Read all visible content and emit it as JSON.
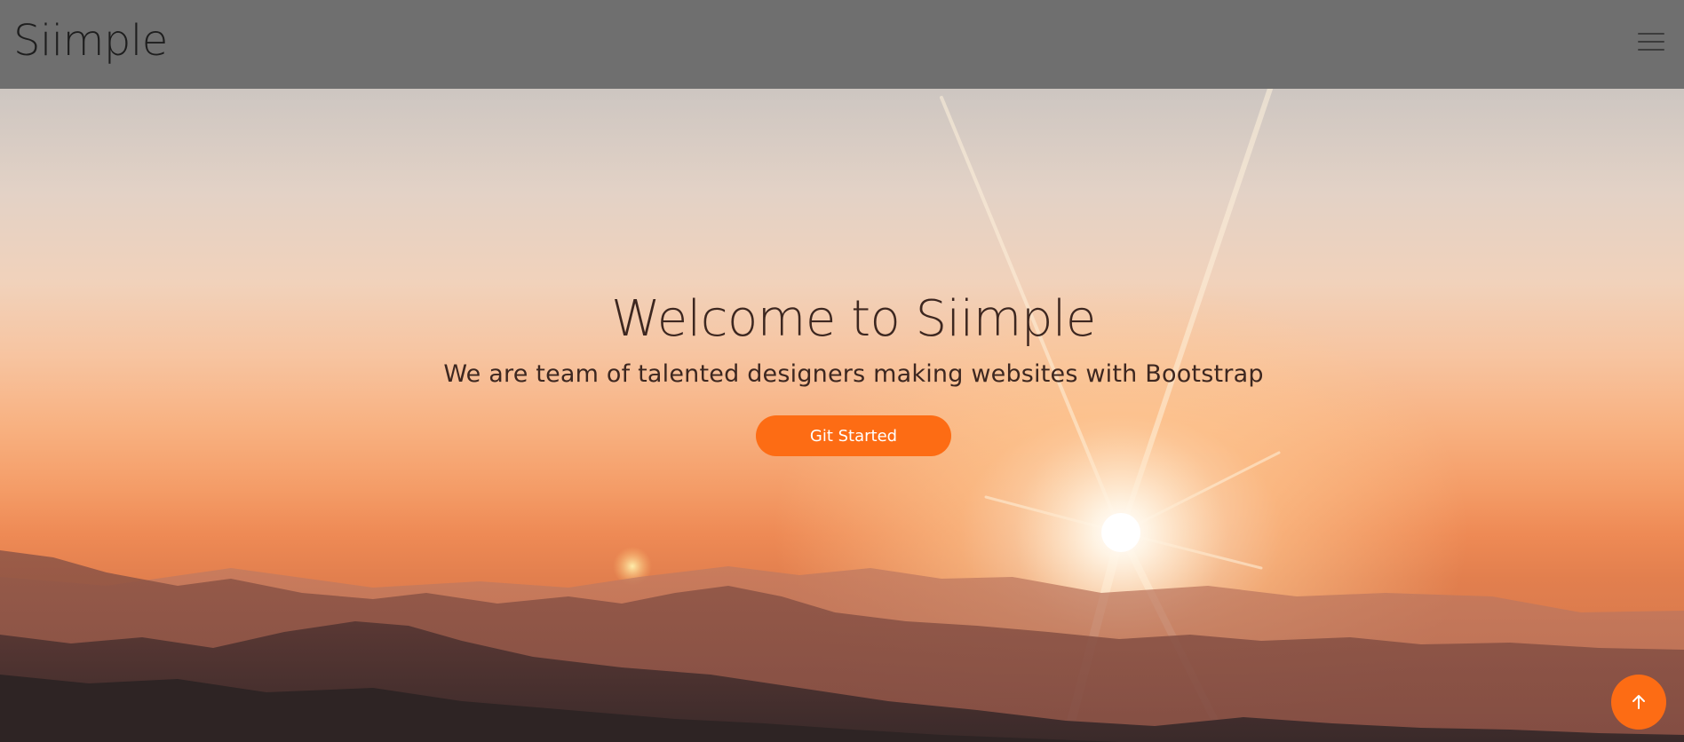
{
  "navbar": {
    "brand": "Siimple",
    "menu_icon": "hamburger-menu-icon"
  },
  "hero": {
    "title": "Welcome to Siimple",
    "subtitle": "We are team of talented designers making websites with Bootstrap",
    "cta_label": "Git Started",
    "background": "sunset-over-mountains-photo"
  },
  "back_to_top": {
    "icon": "arrow-up-icon"
  },
  "colors": {
    "navbar_bg": "#6f6f6f",
    "brand_text": "#1e1e1e",
    "hero_text": "#3d2720",
    "accent": "#fd6c14",
    "button_text": "#ffffff"
  }
}
